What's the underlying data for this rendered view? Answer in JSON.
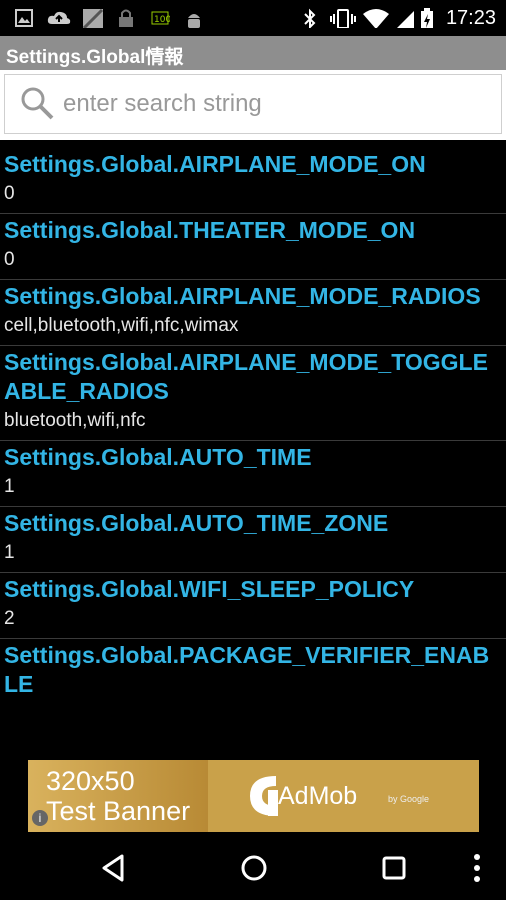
{
  "status_bar": {
    "time": "17:23",
    "icons": [
      "image-icon",
      "cloud-upload-icon",
      "photo-icon",
      "lock-icon",
      "app-icon",
      "android-icon",
      "bluetooth-icon",
      "vibrate-icon",
      "wifi-icon",
      "signal-icon",
      "battery-icon"
    ]
  },
  "app": {
    "title": "Settings.Global情報"
  },
  "search": {
    "placeholder": "enter search string",
    "value": ""
  },
  "items": [
    {
      "key": "Settings.Global.AIRPLANE_MODE_ON",
      "value": "0"
    },
    {
      "key": "Settings.Global.THEATER_MODE_ON",
      "value": "0"
    },
    {
      "key": "Settings.Global.AIRPLANE_MODE_RADIOS",
      "value": "cell,bluetooth,wifi,nfc,wimax"
    },
    {
      "key": "Settings.Global.AIRPLANE_MODE_TOGGLEABLE_RADIOS",
      "value": "bluetooth,wifi,nfc"
    },
    {
      "key": "Settings.Global.AUTO_TIME",
      "value": "1"
    },
    {
      "key": "Settings.Global.AUTO_TIME_ZONE",
      "value": "1"
    },
    {
      "key": "Settings.Global.WIFI_SLEEP_POLICY",
      "value": "2"
    },
    {
      "key": "Settings.Global.PACKAGE_VERIFIER_ENABLE",
      "value": ""
    }
  ],
  "ad": {
    "line1": "320x50",
    "line2": "Test Banner",
    "brand": "AdMob",
    "by": "by Google",
    "info": "i"
  },
  "colors": {
    "accent": "#33b5e5",
    "title_bar": "#8e8e8e",
    "background": "#000000"
  },
  "nav": [
    "back-icon",
    "home-icon",
    "recents-icon",
    "overflow-menu-icon"
  ]
}
